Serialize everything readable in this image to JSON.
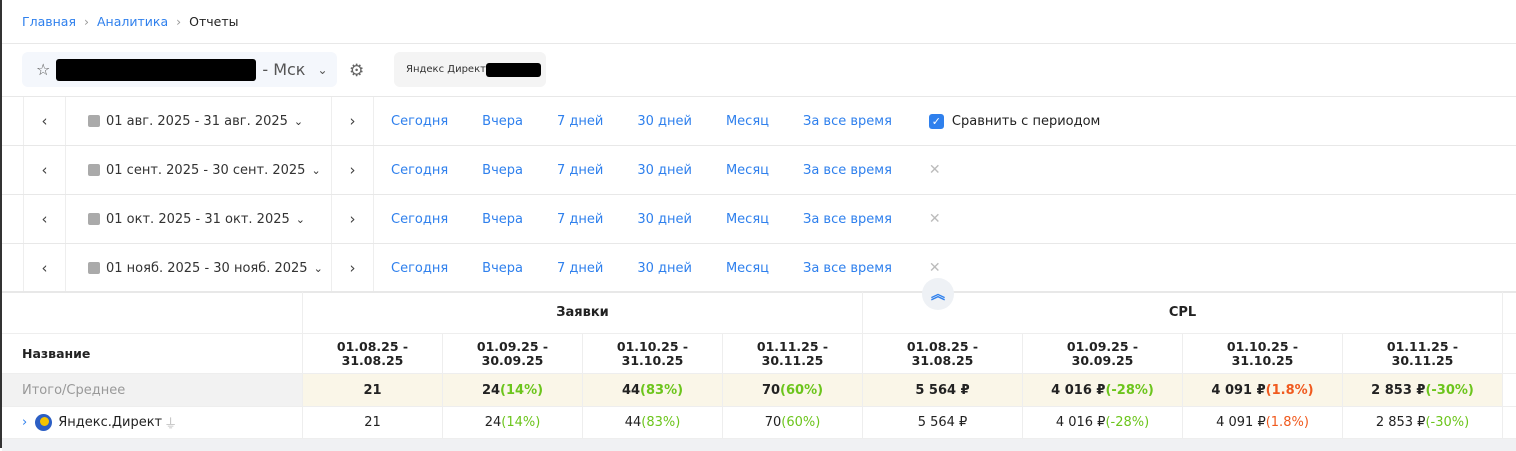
{
  "breadcrumb": [
    "Главная",
    "Аналитика",
    "Отчеты"
  ],
  "project": {
    "name_suffix": "- Мск"
  },
  "source": {
    "label": "Яндекс Директ"
  },
  "date_rows": [
    {
      "range": "01 авг. 2025 - 31 авг. 2025",
      "compare": true
    },
    {
      "range": "01 сент. 2025 - 30 сент. 2025",
      "compare": false
    },
    {
      "range": "01 окт. 2025 - 31 окт. 2025",
      "compare": false
    },
    {
      "range": "01 нояб. 2025 - 30 нояб. 2025",
      "compare": false
    }
  ],
  "quick_links": [
    "Сегодня",
    "Вчера",
    "7 дней",
    "30 дней",
    "Месяц",
    "За все время"
  ],
  "compare_label": "Сравнить с периодом",
  "table": {
    "name_header": "Название",
    "groups": [
      "Заявки",
      "CPL"
    ],
    "periods": [
      "01.08.25 - 31.08.25",
      "01.09.25 - 30.09.25",
      "01.10.25 - 31.10.25",
      "01.11.25 - 30.11.25"
    ],
    "total": {
      "label": "Итого/Среднее",
      "values": [
        [
          "21",
          ""
        ],
        [
          "24",
          "(14%)"
        ],
        [
          "44",
          "(83%)"
        ],
        [
          "70",
          "(60%)"
        ],
        [
          "5 564 ₽",
          ""
        ],
        [
          "4 016 ₽",
          "(-28%)"
        ],
        [
          "4 091 ₽",
          "(1.8%)"
        ],
        [
          "2 853 ₽",
          "(-30%)"
        ]
      ]
    },
    "rows": [
      {
        "label": "Яндекс.Директ",
        "values": [
          [
            "21",
            ""
          ],
          [
            "24",
            "(14%)"
          ],
          [
            "44",
            "(83%)"
          ],
          [
            "70",
            "(60%)"
          ],
          [
            "5 564 ₽",
            ""
          ],
          [
            "4 016 ₽",
            "(-28%)"
          ],
          [
            "4 091 ₽",
            "(1.8%)"
          ],
          [
            "2 853 ₽",
            "(-30%)"
          ]
        ]
      }
    ]
  },
  "colors": {
    "accent": "#2f80ed",
    "positive": "#6cc51c",
    "negative": "#f05a1e"
  }
}
